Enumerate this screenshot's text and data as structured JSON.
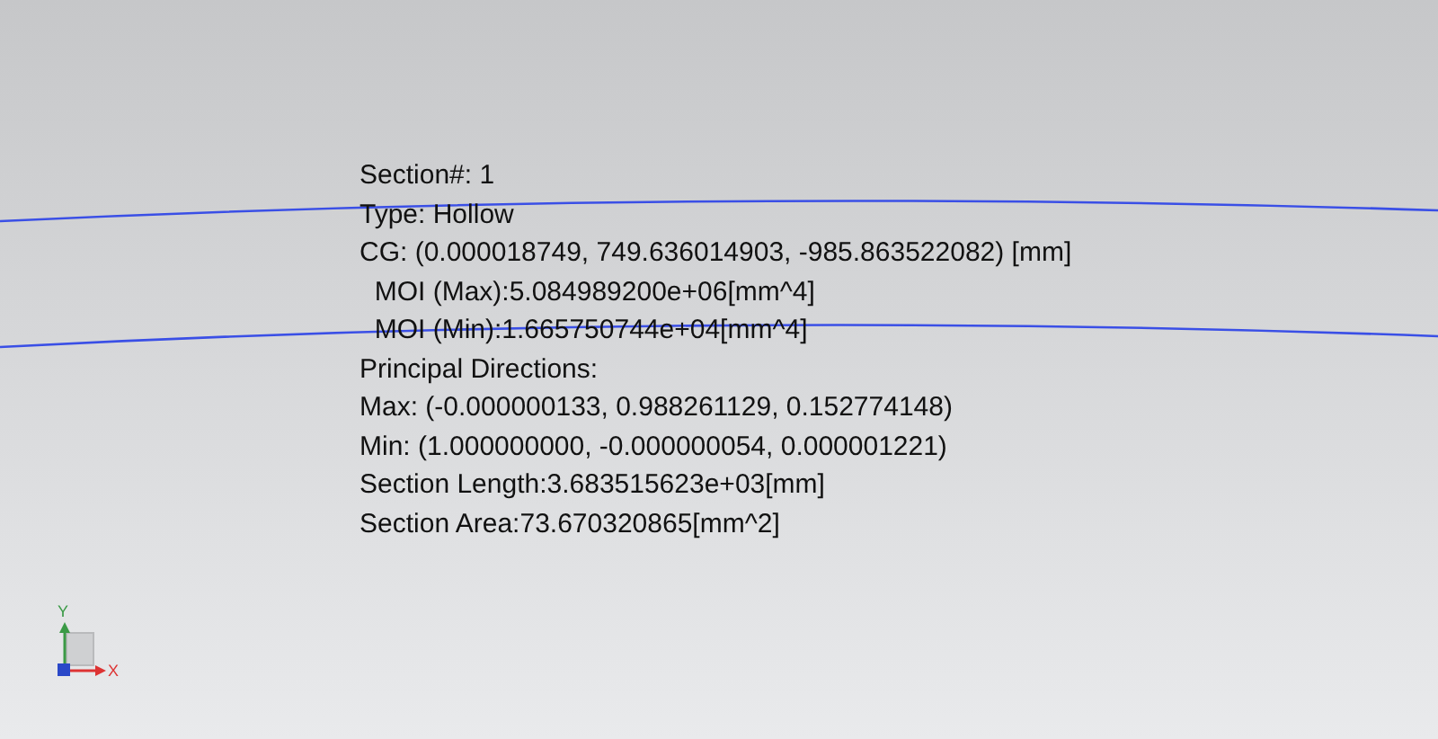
{
  "section_info": [
    "Section#: 1",
    "Type: Hollow",
    "CG: (0.000018749, 749.636014903, -985.863522082) [mm]",
    "  MOI (Max):5.084989200e+06[mm^4]",
    "  MOI (Min):1.665750744e+04[mm^4]",
    "Principal Directions:",
    "Max: (-0.000000133, 0.988261129, 0.152774148)",
    "Min: (1.000000000, -0.000000054, 0.000001221)",
    "Section Length:3.683515623e+03[mm]",
    "Section Area:73.670320865[mm^2]"
  ],
  "triad": {
    "y_label": "Y",
    "x_label": "X"
  }
}
